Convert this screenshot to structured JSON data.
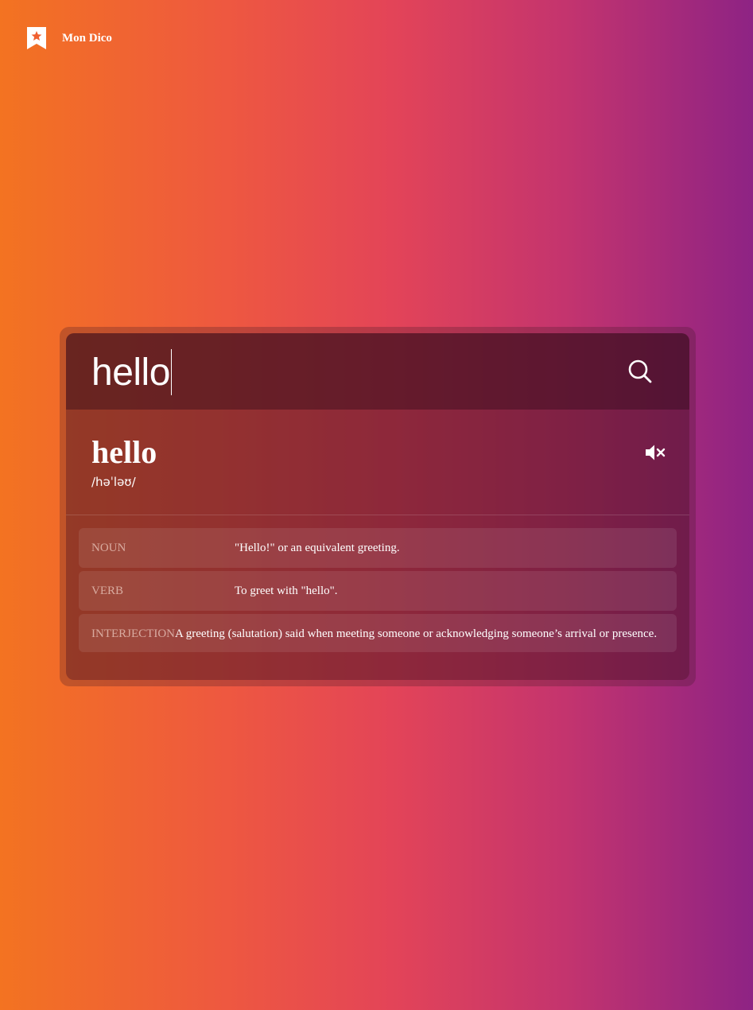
{
  "brand": {
    "name": "Mon Dico",
    "icon": "bookmark-star-icon"
  },
  "search": {
    "value": "hello",
    "icon": "search-icon"
  },
  "entry": {
    "word": "hello",
    "phonetic": "/həˈləʊ/",
    "sound_icon": "speaker-muted-icon"
  },
  "definitions": [
    {
      "pos": "NOUN",
      "text": "\"Hello!\" or an equivalent greeting."
    },
    {
      "pos": "VERB",
      "text": "To greet with \"hello\"."
    },
    {
      "pos": "INTERJECTION",
      "text": "A greeting (salutation) said when meeting someone or acknowledging someone’s arrival or presence."
    }
  ],
  "colors": {
    "gradient_start": "#f37321",
    "gradient_end": "#8e2384",
    "text": "#ffffff"
  }
}
